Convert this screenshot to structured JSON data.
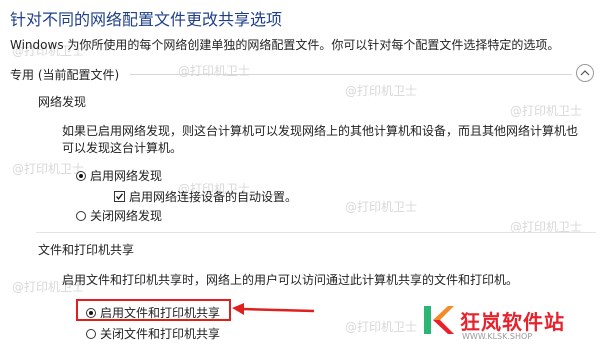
{
  "page": {
    "title": "针对不同的网络配置文件更改共享选项",
    "description": "Windows 为你所使用的每个网络创建单独的网络配置文件。你可以针对每个配置文件选择特定的选项。"
  },
  "section": {
    "header": "专用 (当前配置文件)",
    "network_discovery": {
      "title": "网络发现",
      "paragraph_line1": "如果已启用网络发现，则这台计算机可以发现网络上的其他计算机和设备，而且其他网络计算机也",
      "paragraph_line2": "可以发现这台计算机。",
      "option_on": "启用网络发现",
      "auto_setup": "启用网络连接设备的自动设置。",
      "option_off": "关闭网络发现",
      "selected": "on",
      "auto_setup_checked": true
    },
    "file_printer_sharing": {
      "title": "文件和打印机共享",
      "paragraph": "启用文件和打印机共享时，网络上的用户可以访问通过此计算机共享的文件和打印机。",
      "option_on": "启用文件和打印机共享",
      "option_off": "关闭文件和打印机共享",
      "selected": "on"
    }
  },
  "watermark": {
    "text": "@打印机卫士"
  },
  "brand": {
    "name": "狂岚软件站",
    "url": "WWW.KLSK.SHOP"
  },
  "colors": {
    "title": "#1e3f8a",
    "highlight": "#e01f1f",
    "brand": "#e8222d"
  }
}
